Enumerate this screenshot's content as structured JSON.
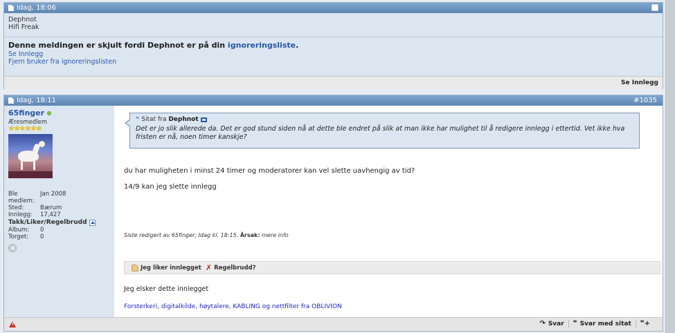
{
  "ignored_post": {
    "header_time": "Idag, 18:06",
    "username": "Dephnot",
    "user_title": "Hifi Freak",
    "notice_prefix": "Denne meldingen er skjult fordi Dephnot er på din",
    "notice_link": "ignoreringsliste",
    "notice_suffix": ".",
    "view_post_link": "Se Innlegg",
    "remove_link": "Fjern bruker fra ignoreringslisten",
    "footer_view": "Se Innlegg"
  },
  "main_post": {
    "header_time": "Idag, 18:11",
    "post_number": "#1035",
    "user": {
      "name": "65finger",
      "title": "Æresmedlem",
      "stars": "★★★★★★",
      "stats": [
        {
          "key": "Ble medlem:",
          "value": "Jan 2008"
        },
        {
          "key": "Sted:",
          "value": "Bærum"
        },
        {
          "key": "Innlegg:",
          "value": "17,427"
        }
      ],
      "takk_label": "Takk/Liker/Regelbrudd",
      "stats2": [
        {
          "key": "Album:",
          "value": "0"
        },
        {
          "key": "Torget:",
          "value": "0"
        }
      ]
    },
    "quote": {
      "prefix": "Sitat fra",
      "author": "Dephnot",
      "text": "Det er jo slik allerede da. Det er god stund siden nå at dette ble endret på slik at man ikke har mulighet til å redigere innlegg i ettertid. Vet ikke hva fristen er nå, noen timer kanskje?"
    },
    "message": [
      "du har muligheten i minst 24 timer og moderatorer kan vel slette uavhengig av tid?",
      "14/9 kan jeg slette innlegg"
    ],
    "edited_prefix": "Siste redigert av 65finger; Idag kl. 18:15.",
    "edited_reason_label": "Årsak:",
    "edited_reason": "mere info",
    "like_button": "Jeg liker innlegget",
    "rule_button": "Regelbrudd?",
    "like_text": "Jeg elsker dette innlegget",
    "signature": "Forsterkeri, digitalkilde, høytalere, KABLING og nettfilter fra OBLIVION",
    "footer": {
      "reply": "Svar",
      "reply_quote": "Svar med sitat",
      "multiquote_icon": "multi-quote-icon"
    }
  }
}
